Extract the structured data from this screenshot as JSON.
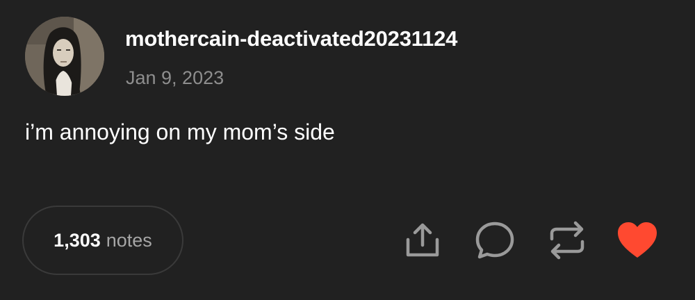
{
  "post": {
    "username": "mothercain-deactivated20231124",
    "date": "Jan 9, 2023",
    "body": "i’m annoying on my mom’s side",
    "notes": {
      "count": "1,303",
      "label": "notes"
    },
    "actions": [
      {
        "icon": "share-icon"
      },
      {
        "icon": "reply-icon"
      },
      {
        "icon": "reblog-icon"
      },
      {
        "icon": "heart-icon",
        "liked": true
      }
    ]
  },
  "colors": {
    "background": "#212121",
    "text": "#ffffff",
    "muted": "#8e8e8e",
    "icon": "#9a9a9a",
    "heart": "#ff4930",
    "pill_border": "#3a3a3a"
  }
}
